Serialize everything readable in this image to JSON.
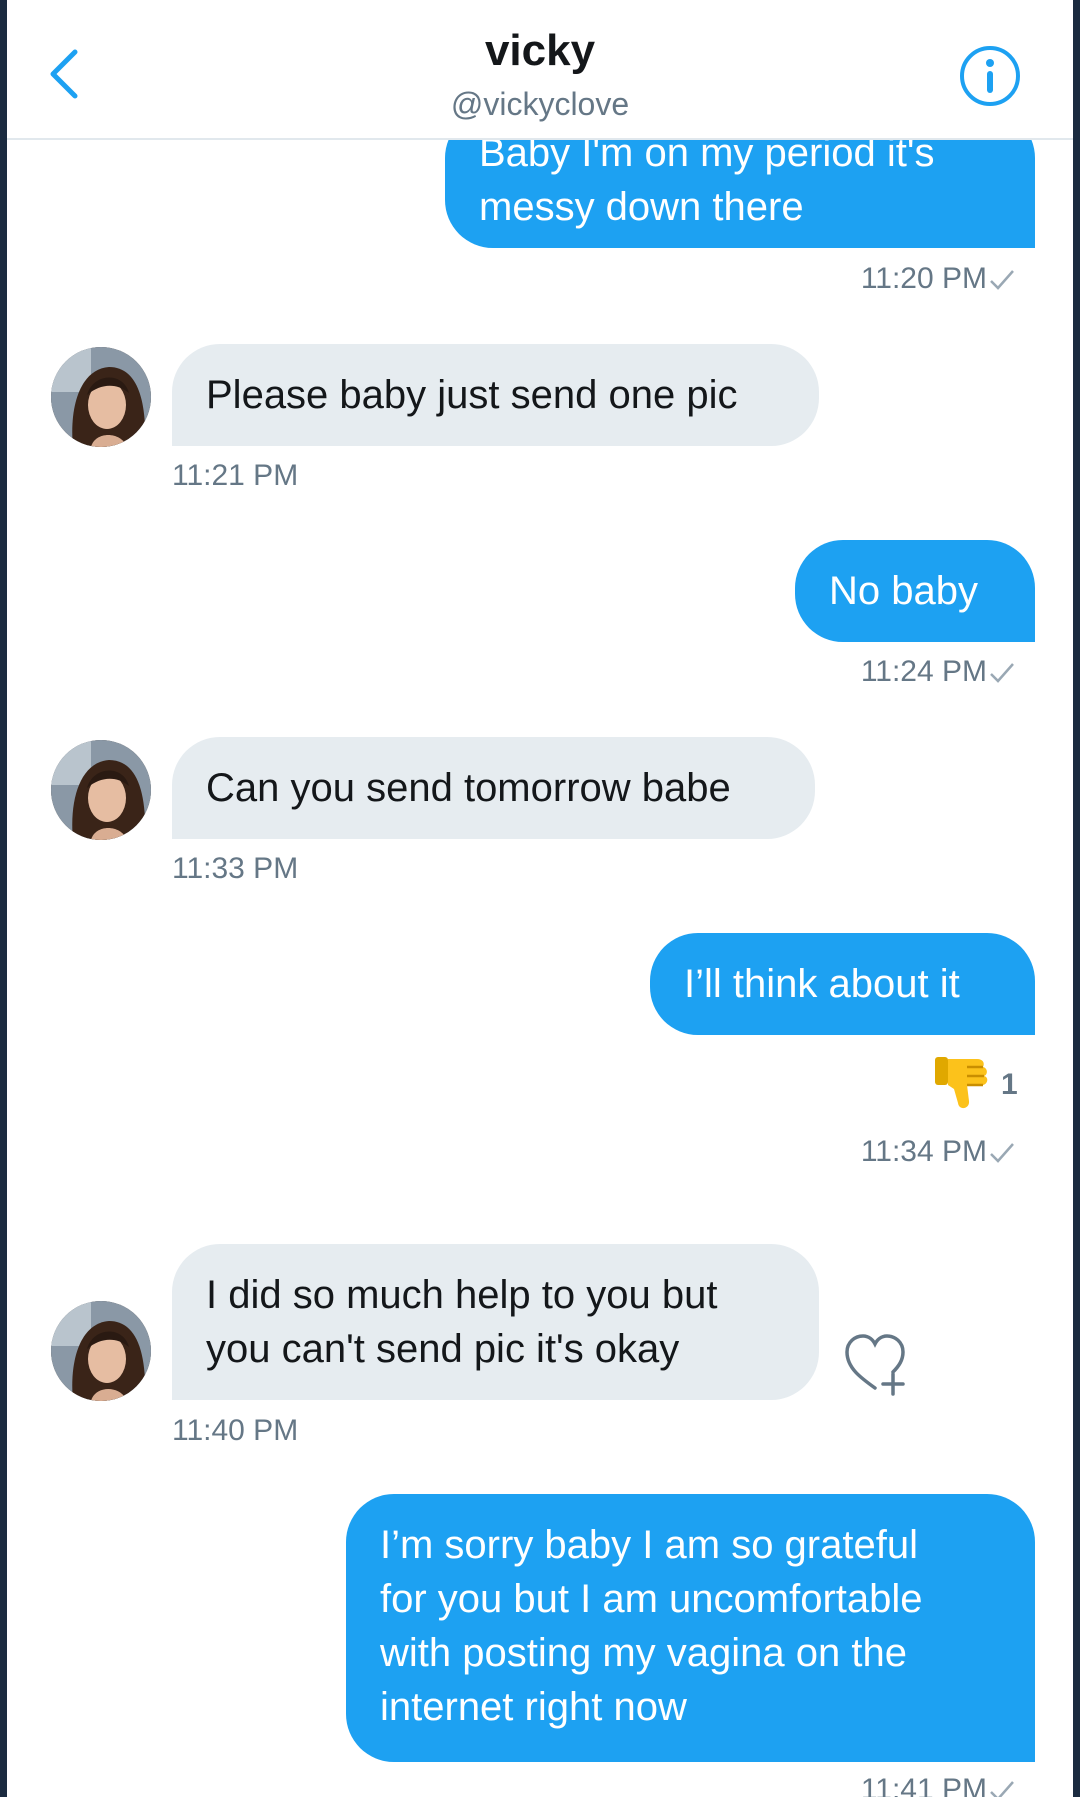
{
  "header": {
    "title": "vicky",
    "handle": "@vickyclove"
  },
  "messages": [
    {
      "from": "me",
      "lines": [
        "Baby I'm on my period it's",
        "messy down there"
      ],
      "time": "11:20 PM"
    },
    {
      "from": "vicky",
      "lines": [
        "Please baby just send one pic"
      ],
      "time": "11:21 PM"
    },
    {
      "from": "me",
      "lines": [
        "No baby"
      ],
      "time": "11:24 PM"
    },
    {
      "from": "vicky",
      "lines": [
        "Can you send tomorrow babe"
      ],
      "time": "11:33 PM"
    },
    {
      "from": "me",
      "lines": [
        "I’ll think about it"
      ],
      "time": "11:34 PM",
      "reaction": {
        "icon": "thumbs-down-emoji",
        "count": "1"
      }
    },
    {
      "from": "vicky",
      "lines": [
        "I did so much help to you but",
        "you can't send pic it's okay"
      ],
      "time": "11:40 PM"
    },
    {
      "from": "me",
      "lines": [
        "I’m sorry baby I am so grateful",
        "for you but I am uncomfortable",
        "with posting my vagina on the",
        "internet right now"
      ],
      "time": "11:41 PM"
    }
  ],
  "icons": {
    "back": "chevron-left-icon",
    "info": "info-icon",
    "read": "checkmark-icon",
    "add_reaction": "heart-plus-icon"
  },
  "colors": {
    "accent": "#1da1f2",
    "incoming_bubble": "#e6ecf0",
    "timestamp": "#657786"
  }
}
